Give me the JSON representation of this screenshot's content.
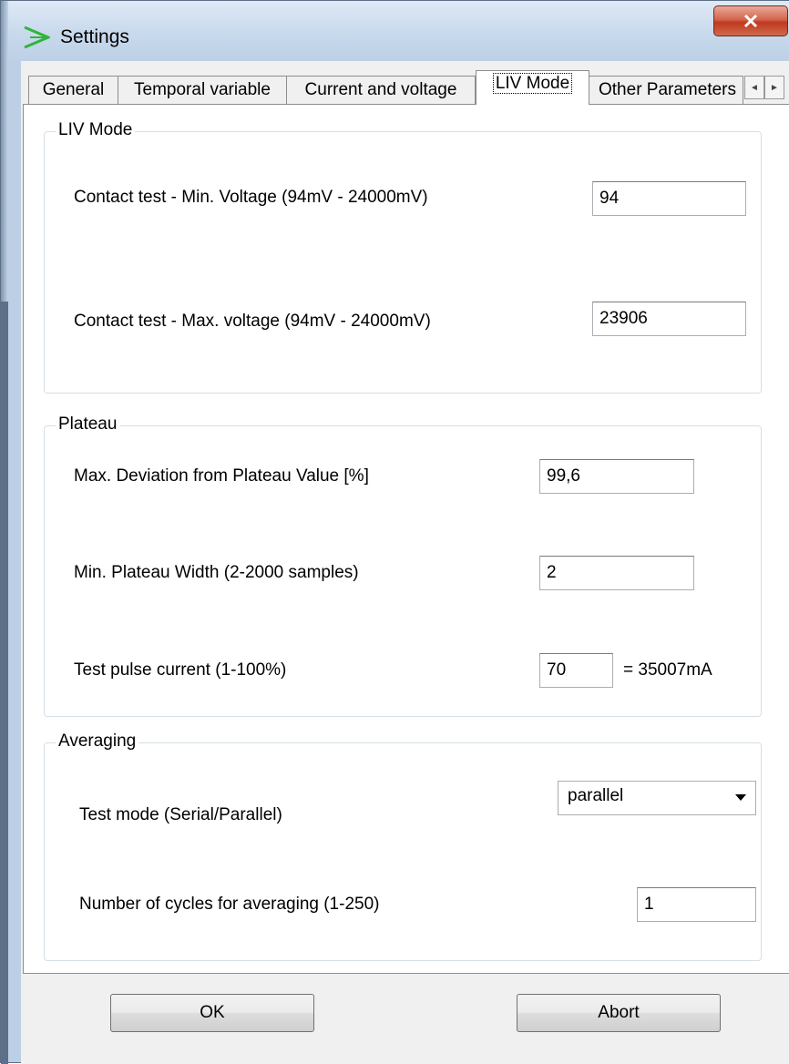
{
  "window": {
    "title": "Settings",
    "icon": "app-arrow-icon",
    "close_symbol": "X"
  },
  "tabs": [
    {
      "label": "General",
      "active": false
    },
    {
      "label": "Temporal variable",
      "active": false
    },
    {
      "label": "Current and voltage",
      "active": false
    },
    {
      "label": "LIV Mode",
      "active": true
    },
    {
      "label": "Other Parameters",
      "active": false
    }
  ],
  "tab_scroll": {
    "left": "◄",
    "right": "►"
  },
  "liv_mode": {
    "group_label": "LIV Mode",
    "min_voltage_label": "Contact test - Min. Voltage (94mV  - 24000mV)",
    "min_voltage_value": "94",
    "max_voltage_label": "Contact test - Max. voltage  (94mV  - 24000mV)",
    "max_voltage_value": "23906"
  },
  "plateau": {
    "group_label": "Plateau",
    "max_deviation_label": "Max. Deviation from Plateau Value [%]",
    "max_deviation_value": "99,6",
    "min_width_label": "Min. Plateau Width (2-2000 samples)",
    "min_width_value": "2",
    "pulse_current_label": "Test pulse current (1-100%)",
    "pulse_current_value": "70",
    "pulse_current_result": "= 35007mA"
  },
  "averaging": {
    "group_label": "Averaging",
    "test_mode_label": "Test mode (Serial/Parallel)",
    "test_mode_value": "parallel",
    "cycles_label": "Number of cycles for averaging (1-250)",
    "cycles_value": "1"
  },
  "buttons": {
    "ok": "OK",
    "abort": "Abort"
  },
  "colors": {
    "title_bar": "#c8d9ec",
    "close_button": "#c0391f",
    "panel": "#ffffff",
    "dialog": "#f0f0f0"
  }
}
